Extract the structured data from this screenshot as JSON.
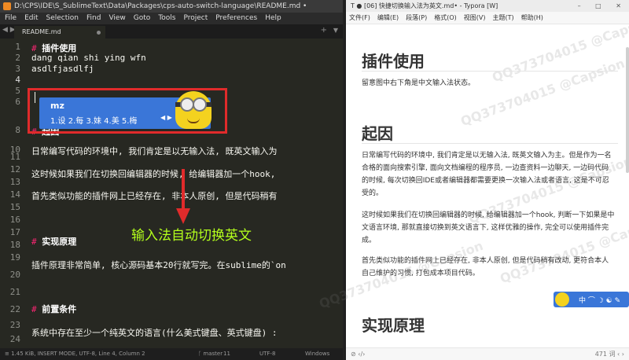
{
  "sublime": {
    "title": "D:\\CPS\\IDE\\S_SublimeText\\Data\\Packages\\cps-auto-switch-language\\README.md •",
    "menu": [
      "File",
      "Edit",
      "Selection",
      "Find",
      "View",
      "Goto",
      "Tools",
      "Project",
      "Preferences",
      "Help"
    ],
    "tab_nav": "◀ ▶",
    "tab_label": "README.md",
    "new_tab": "+",
    "tab_list": "▼",
    "line_numbers": [
      "1",
      "2",
      "3",
      "4",
      "5",
      "6",
      "7",
      "8",
      "9",
      "10",
      "11",
      "12",
      "13",
      "14",
      "15",
      "16",
      "17",
      "18",
      "19"
    ],
    "lines": {
      "l1_marker": "#",
      "l1_text": " 插件使用",
      "l2": "dang qian shi ying wfn",
      "l3": "asdlfjasdlfj",
      "l8_marker": "#",
      "l8_text": " 起因",
      "l10": "日常编写代码的环境中, 我们肯定是以无输入法, 既英文输入为",
      "l12": "这时候如果我们在切换回编辑器的时候, 给编辑器加一个hook,",
      "l14": "首先类似功能的插件网上已经存在, 非本人原创, 但是代码稍有",
      "l17_marker": "#",
      "l17_text": " 实现原理",
      "l19": "插件原理非常简单, 核心源码基本20行就写完。在sublime的`on",
      "l22_marker": "#",
      "l22_text": " 前置条件",
      "l24": "系统中存在至少一个纯英文的语言(什么美式键盘、英式键盘) :"
    },
    "extra_line_numbers": [
      "20",
      "21",
      "22",
      "23",
      "24"
    ],
    "ime": {
      "composition": "mz",
      "candidates": "1.设  2.每  3.妹  4.美  5.梅",
      "pager": "◀ ▶"
    },
    "annotation": "输入法自动切换英文",
    "status": {
      "left": "≡ 1.45 KiB, INSERT MODE, UTF-8, Line 4, Column 2",
      "branch": "ᚴ master",
      "count": "11",
      "encoding": "UTF-8",
      "line_endings": "Windows"
    }
  },
  "typora": {
    "title": "T  ●  [06] 快捷切换输入法为英文.md• - Typora [W]",
    "window_controls": "– □ ✕",
    "menu": [
      "文件(F)",
      "编辑(E)",
      "段落(P)",
      "格式(O)",
      "视图(V)",
      "主题(T)",
      "帮助(H)"
    ],
    "doc": {
      "h1_usage": "插件使用",
      "p_usage": "留意图中右下角是中文输入法状态。",
      "h1_cause": "起因",
      "p_cause1": "日常编写代码的环境中, 我们肯定是以无输入法, 既英文输入为主。但是作为一名合格的面向搜索引擎, 面向文档编程的程序员, 一边查资料一边聊天, 一边码代码的时候, 每次切换回IDE或者编辑器都需要更换一次输入法或者语言, 这是不可忍受的。",
      "p_cause2": "这时候如果我们在切换回编辑器的时候, 给编辑器加一个hook, 判断一下如果是中文语言环境, 那就直接切换到英文语言下, 这样优雅的操作, 完全可以使用插件完成。",
      "p_cause3": "首先类似功能的插件网上已经存在, 非本人原创, 但是代码稍有改动, 更符合本人自己维护的习惯, 打包成本项目代码。",
      "h1_principle": "实现原理"
    },
    "ime_bar": "中  ⌒  ☽  ☯  ✎",
    "status": {
      "left": "⊘  ‹/›",
      "right": "471 词  ‹  ›"
    },
    "watermarks": [
      "QQ373704015 @Capsion",
      "QQ373704015 @Capsion",
      "QQ373704015 @Capsion",
      "QQ373704015 @Capsion",
      "QQ373704015 @Capsion"
    ]
  },
  "colors": {
    "editor_bg": "#272822",
    "ime_blue": "#3a76d8",
    "highlight_red": "#e02b2b",
    "annotation_green": "#b4ff1c",
    "markdown_hash": "#f92672"
  }
}
